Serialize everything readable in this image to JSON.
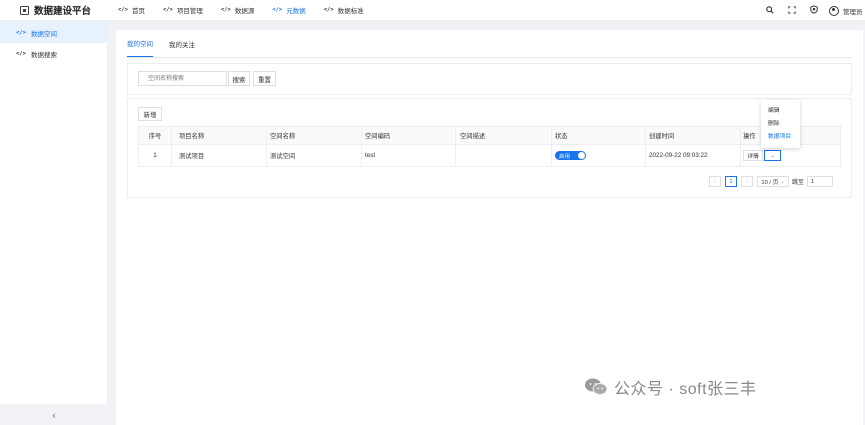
{
  "header": {
    "logo_text": "数据建设平台",
    "nav": [
      {
        "label": "首页",
        "active": false
      },
      {
        "label": "项目管理",
        "active": false
      },
      {
        "label": "数据源",
        "active": false
      },
      {
        "label": "元数据",
        "active": true
      },
      {
        "label": "数据标准",
        "active": false
      }
    ],
    "user_name": "管理员"
  },
  "sidebar": {
    "items": [
      {
        "label": "数据空间",
        "active": true
      },
      {
        "label": "数据搜索",
        "active": false
      }
    ],
    "collapse_icon": "‹"
  },
  "tabs": [
    {
      "label": "我的空间",
      "active": true
    },
    {
      "label": "我的关注",
      "active": false
    }
  ],
  "search": {
    "placeholder": "空间名称搜索",
    "search_label": "搜索",
    "reset_label": "重置"
  },
  "toolbar": {
    "add_label": "新增"
  },
  "table": {
    "columns": [
      "序号",
      "项目名称",
      "空间名称",
      "空间编码",
      "空间描述",
      "状态",
      "创建时间",
      "操作"
    ],
    "rows": [
      {
        "index": "1",
        "project": "测试项目",
        "space_name": "测试空间",
        "code": "test",
        "desc": "",
        "status": "启用",
        "created": "2022-09-22 09:03:22",
        "detail_label": "详情",
        "more_label": "⌄"
      }
    ]
  },
  "pagination": {
    "current_page": "1",
    "page_size": "10 / 页",
    "goto_label": "跳至",
    "goto_value": "1"
  },
  "dropdown_menu": {
    "items": [
      {
        "label": "编辑",
        "highlight": false
      },
      {
        "label": "删除",
        "highlight": false
      },
      {
        "label": "数据项目",
        "highlight": true
      }
    ]
  },
  "watermark": {
    "text": "公众号 · soft张三丰"
  },
  "colors": {
    "accent": "#1a73e8",
    "background": "#f0f2f5"
  }
}
